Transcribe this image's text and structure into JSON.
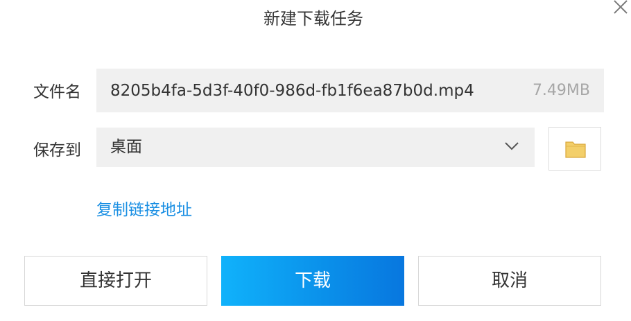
{
  "dialog": {
    "title": "新建下载任务"
  },
  "file": {
    "label": "文件名",
    "name": "8205b4fa-5d3f-40f0-986d-fb1f6ea87b0d.mp4",
    "size": "7.49MB"
  },
  "save": {
    "label": "保存到",
    "selected": "桌面"
  },
  "links": {
    "copy_link": "复制链接地址"
  },
  "buttons": {
    "open_label": "直接打开",
    "download_label": "下载",
    "cancel_label": "取消"
  },
  "icons": {
    "close": "close-icon",
    "dropdown": "chevron-down-icon",
    "folder": "folder-icon"
  },
  "colors": {
    "link": "#1a8fe3",
    "primary_start": "#10b2fb",
    "primary_end": "#0877df",
    "folder": "#f3cf6a"
  }
}
